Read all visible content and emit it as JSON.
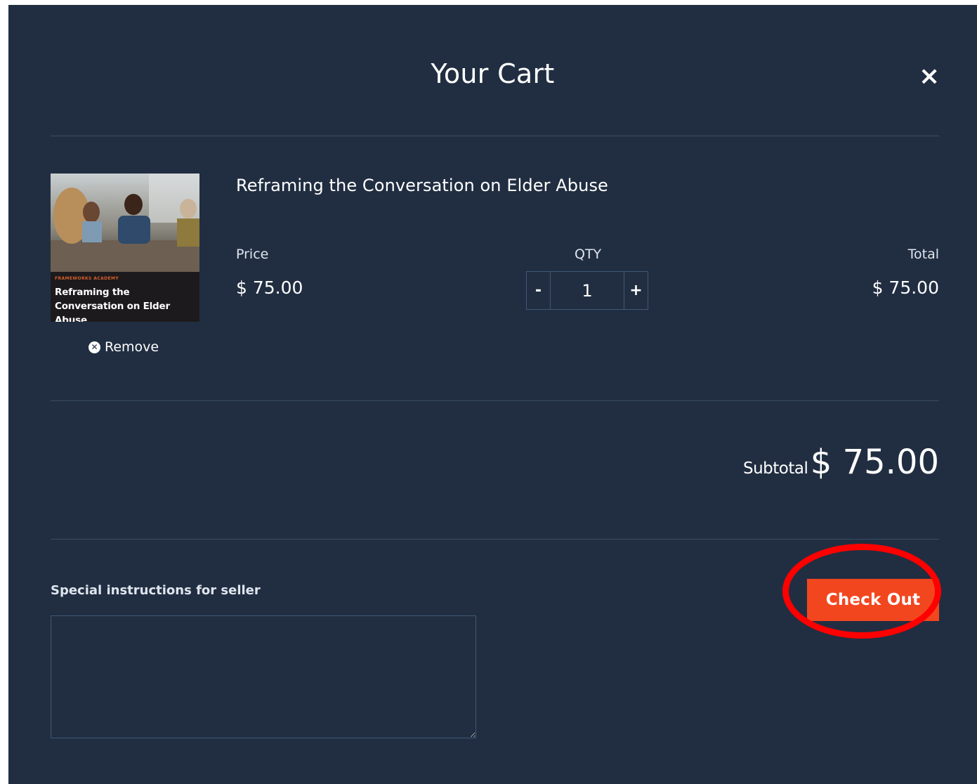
{
  "cart": {
    "title": "Your Cart",
    "close_glyph": "×"
  },
  "item": {
    "title": "Reframing the Conversation on Elder Abuse",
    "thumbnail": {
      "brand": "FRAMEWORKS ACADEMY",
      "caption": "Reframing the Conversation on Elder Abuse"
    },
    "remove_label": "Remove",
    "price_label": "Price",
    "price": "$ 75.00",
    "qty_label": "QTY",
    "quantity": "1",
    "decrement_glyph": "-",
    "increment_glyph": "+",
    "total_label": "Total",
    "total": "$ 75.00"
  },
  "summary": {
    "subtotal_label": "Subtotal",
    "subtotal": "$ 75.00"
  },
  "instructions": {
    "label": "Special instructions for seller",
    "value": "",
    "placeholder": ""
  },
  "checkout": {
    "label": "Check Out"
  },
  "colors": {
    "background": "#212e41",
    "accent": "#f2461f",
    "annotation": "#ff0000"
  }
}
